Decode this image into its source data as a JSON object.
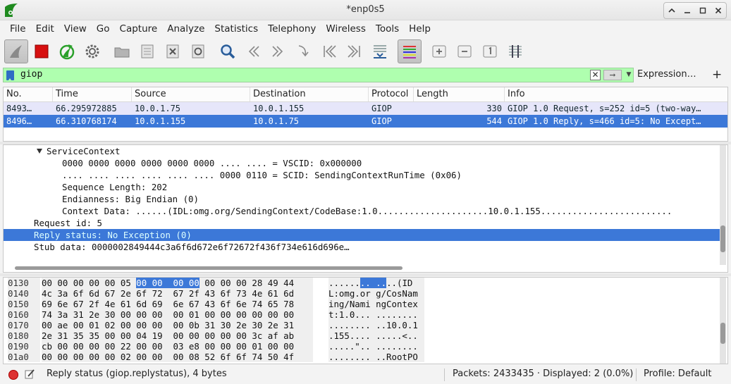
{
  "window": {
    "title": "*enp0s5",
    "controls": [
      "up-icon",
      "minimize-icon",
      "maximize-icon",
      "close-icon"
    ]
  },
  "menu": [
    "File",
    "Edit",
    "View",
    "Go",
    "Capture",
    "Analyze",
    "Statistics",
    "Telephony",
    "Wireless",
    "Tools",
    "Help"
  ],
  "toolbar": {
    "buttons": [
      "start-capture",
      "stop-capture",
      "restart-capture",
      "capture-options",
      "open-file",
      "save-file",
      "close-file",
      "reload-file",
      "find-packet",
      "go-back",
      "go-forward",
      "go-to-packet",
      "go-first",
      "go-last",
      "auto-scroll",
      "colorize",
      "zoom-in",
      "zoom-out",
      "normal-size",
      "resize-columns"
    ]
  },
  "filter": {
    "value": "giop",
    "expression_label": "Expression…",
    "add_label": "+"
  },
  "packet_list": {
    "columns": [
      "No.",
      "Time",
      "Source",
      "Destination",
      "Protocol",
      "Length",
      "Info"
    ],
    "rows": [
      {
        "no": "8493…",
        "time": "66.295972885",
        "source": "10.0.1.75",
        "destination": "10.0.1.155",
        "protocol": "GIOP",
        "length": "330",
        "info": "GIOP 1.0 Request, s=252 id=5 (two-way…"
      },
      {
        "no": "8496…",
        "time": "66.310768174",
        "source": "10.0.1.155",
        "destination": "10.0.1.75",
        "protocol": "GIOP",
        "length": "544",
        "info": "GIOP 1.0 Reply, s=466 id=5: No Except…"
      }
    ]
  },
  "details": {
    "lines": [
      "ServiceContext",
      "0000 0000 0000 0000 0000 0000 .... .... = VSCID: 0x000000",
      ".... .... .... .... .... .... 0000 0110 = SCID: SendingContextRunTime (0x06)",
      "Sequence Length: 202",
      "Endianness: Big Endian (0)",
      "Context Data: ......(IDL:omg.org/SendingContext/CodeBase:1.0.....................10.0.1.155.........................",
      "Request id: 5",
      "Reply status: No Exception (0)",
      "Stub data: 0000002849444c3a6f6d672e6f72672f436f734e616d696e…"
    ]
  },
  "bytes": {
    "rows": [
      {
        "offset": "0130",
        "hex_pre": "00 00 00 00 00 05 ",
        "hex_hl": "00 00  00 00",
        "hex_post": " 00 00 00 28 49 44",
        "ascii_pre": "......",
        "ascii_hl": ".. ..",
        "ascii_post": "..(ID"
      },
      {
        "offset": "0140",
        "hex": "4c 3a 6f 6d 67 2e 6f 72  67 2f 43 6f 73 4e 61 6d",
        "ascii": "L:omg.or g/CosNam"
      },
      {
        "offset": "0150",
        "hex": "69 6e 67 2f 4e 61 6d 69  6e 67 43 6f 6e 74 65 78",
        "ascii": "ing/Nami ngContex"
      },
      {
        "offset": "0160",
        "hex": "74 3a 31 2e 30 00 00 00  00 01 00 00 00 00 00 00",
        "ascii": "t:1.0... ........"
      },
      {
        "offset": "0170",
        "hex": "00 ae 00 01 02 00 00 00  00 0b 31 30 2e 30 2e 31",
        "ascii": "........ ..10.0.1"
      },
      {
        "offset": "0180",
        "hex": "2e 31 35 35 00 00 04 19  00 00 00 00 00 3c af ab",
        "ascii": ".155.... .....<.."
      },
      {
        "offset": "0190",
        "hex": "cb 00 00 00 00 22 00 00  03 e8 00 00 00 01 00 00",
        "ascii": ".....\".. ........"
      },
      {
        "offset": "01a0",
        "hex": "00 00 00 00 00 02 00 00  00 08 52 6f 6f 74 50 4f",
        "ascii": "........ ..RootPO"
      }
    ]
  },
  "status": {
    "field_text": "Reply status (giop.replystatus), 4 bytes",
    "packets_text": "Packets: 2433435 · Displayed: 2 (0.0%)",
    "profile_text": "Profile: Default"
  },
  "colors": {
    "selection": "#3c78d8",
    "filter_ok": "#afffaf",
    "row_request": "#e6e6fa"
  }
}
